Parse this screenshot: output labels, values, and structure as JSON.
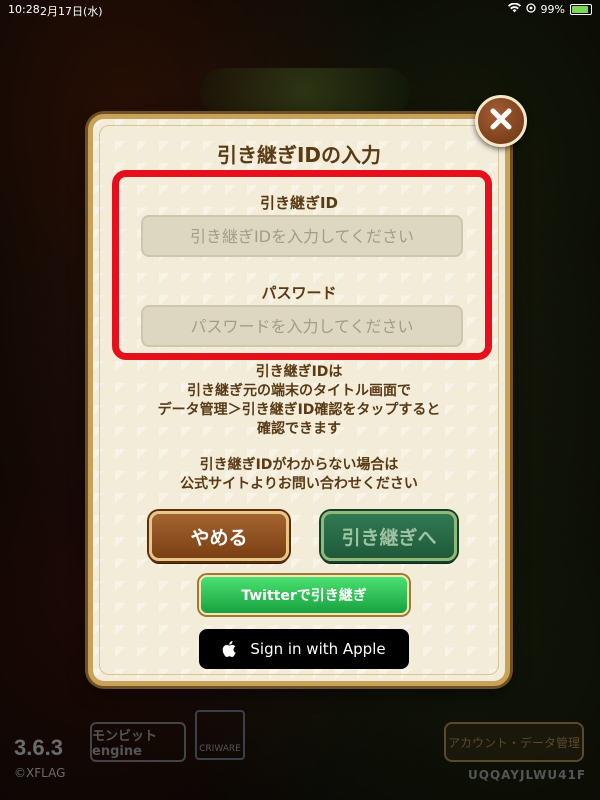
{
  "status_bar": {
    "time": "10:28",
    "date": "2月17日(水)",
    "battery": "99%"
  },
  "background": {
    "version": "3.6.3",
    "copyright": "©XFLAG",
    "engine_logo": "モンビット engine",
    "cri_logo": "CRIWARE",
    "account_button": "アカウント・データ管理",
    "user_code": "UQQAYJLWU41F"
  },
  "dialog": {
    "title": "引き継ぎIDの入力",
    "id_label": "引き継ぎID",
    "id_placeholder": "引き継ぎIDを入力してください",
    "password_label": "パスワード",
    "password_placeholder": "パスワードを入力してください",
    "info_lines": [
      "引き継ぎIDは",
      "引き継ぎ元の端末のタイトル画面で",
      "データ管理＞引き継ぎID確認をタップすると",
      "確認できます",
      "引き継ぎIDがわからない場合は",
      "公式サイトよりお問い合わせください"
    ],
    "cancel_button": "やめる",
    "next_button": "引き継ぎへ",
    "twitter_button": "Twitterで引き継ぎ",
    "apple_button": "Sign in with Apple",
    "close_icon": "close-icon"
  },
  "colors": {
    "highlight": "#e5101c",
    "dialog_bg": "#f2ecd9",
    "text_brown": "#5a3a14"
  }
}
